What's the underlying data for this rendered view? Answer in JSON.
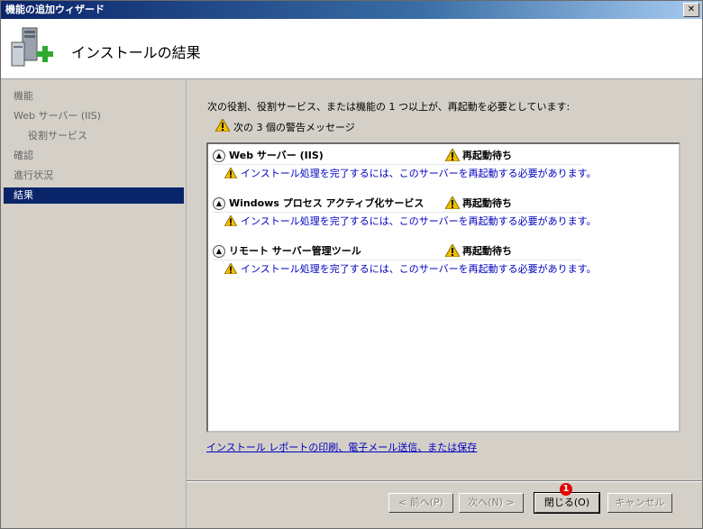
{
  "window": {
    "title": "機能の追加ウィザード"
  },
  "header": {
    "title": "インストールの結果",
    "icon": "server-add-icon"
  },
  "sidebar": {
    "items": [
      {
        "label": "機能"
      },
      {
        "label": "Web サーバー (IIS)"
      },
      {
        "label": "役割サービス"
      },
      {
        "label": "確認"
      },
      {
        "label": "進行状況"
      },
      {
        "label": "結果"
      }
    ]
  },
  "main": {
    "message": "次の役割、役割サービス、または機能の 1 つ以上が、再起動を必要としています:",
    "warning_count": "次の 3 個の警告メッセージ",
    "groups": [
      {
        "name": "Web サーバー (IIS)",
        "status": "再起動待ち",
        "detail": "インストール処理を完了するには、このサーバーを再起動する必要があります。"
      },
      {
        "name": "Windows プロセス アクティブ化サービス",
        "status": "再起動待ち",
        "detail": "インストール処理を完了するには、このサーバーを再起動する必要があります。"
      },
      {
        "name": "リモート サーバー管理ツール",
        "status": "再起動待ち",
        "detail": "インストール処理を完了するには、このサーバーを再起動する必要があります。"
      }
    ],
    "report_link": "インストール レポートの印刷、電子メール送信、または保存"
  },
  "buttons": {
    "prev": "< 前へ(P)",
    "next": "次へ(N) >",
    "close": "閉じる(O)",
    "cancel": "キャンセル"
  },
  "annotation": {
    "badge": "1"
  },
  "colors": {
    "selected": "#0a246a",
    "link": "#0000c0",
    "warning": "#f0c000"
  }
}
